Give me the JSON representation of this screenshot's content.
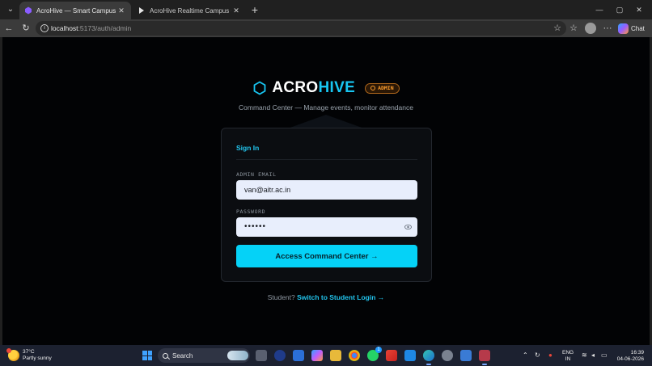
{
  "browser": {
    "tabs": [
      {
        "title": "AcroHive — Smart Campus Events",
        "active": true
      },
      {
        "title": "AcroHive Realtime Campus OS - E",
        "active": false
      }
    ],
    "url_host": "localhost",
    "url_path": ":5173/auth/admin",
    "chat_label": "Chat",
    "icons": [
      "tab-actions-icon",
      "close-icon",
      "new-tab-icon",
      "minimize-icon",
      "maximize-icon",
      "back-icon",
      "refresh-icon",
      "info-icon",
      "favorite-star-icon",
      "collections-icon",
      "profile-icon",
      "more-icon",
      "copilot-icon"
    ]
  },
  "page": {
    "brand_acro": "ACRO",
    "brand_hive": "HIVE",
    "badge": "ADMIN",
    "tagline": "Command Center — Manage events, monitor attendance",
    "card_title": "Sign In",
    "email_label": "ADMIN EMAIL",
    "email_value": "van@aitr.ac.in",
    "password_label": "PASSWORD",
    "password_value": "••••••",
    "submit_label": "Access Command Center →",
    "switch_prompt": "Student?",
    "switch_link": "Switch to Student Login →",
    "colors": {
      "accent": "#18c6f2",
      "button": "#05d2f7",
      "badge": "#ff9f2e",
      "background": "#020305"
    }
  },
  "taskbar": {
    "temperature": "37°C",
    "weather": "Partly sunny",
    "search_label": "Search",
    "lang_top": "ENG",
    "lang_bottom": "IN",
    "time": "16:39",
    "date": "04-06-2026",
    "notification_count": "1"
  }
}
